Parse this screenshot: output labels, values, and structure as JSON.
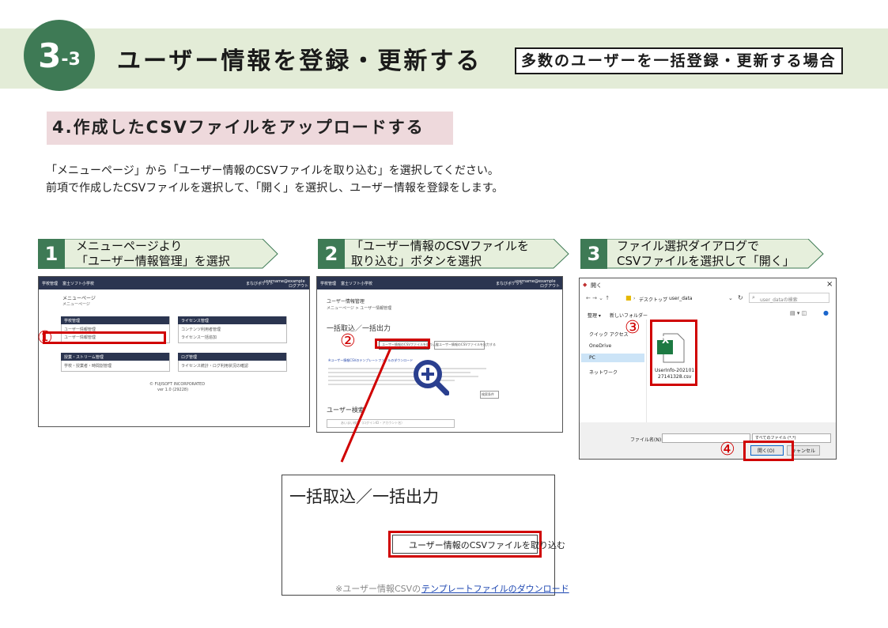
{
  "header": {
    "badge_num": "3",
    "badge_sub": "-3",
    "title": "ユーザー情報を登録・更新する",
    "tag": "多数のユーザーを一括登録・更新する場合"
  },
  "section": {
    "title": "4.作成したCSVファイルをアップロードする"
  },
  "description": {
    "line1": "「メニューページ」から「ユーザー情報のCSVファイルを取り込む」を選択してください。",
    "line2": "前項で作成したCSVファイルを選択して、「開く」を選択し、ユーザー情報を登録をします。"
  },
  "steps": [
    {
      "num": "1",
      "line1": "メニューページより",
      "line2": "「ユーザー情報管理」を選択"
    },
    {
      "num": "2",
      "line1": "「ユーザー情報のCSVファイルを",
      "line2": "取り込む」ボタンを選択"
    },
    {
      "num": "3",
      "line1": "ファイル選択ダイアログで",
      "line2": "CSVファイルを選択して「開く」"
    }
  ],
  "markers": [
    "①",
    "②",
    "③",
    "④"
  ],
  "shot1": {
    "app_title": "学校管理",
    "school": "富士ソフト小学校",
    "brand": "まなびポケット",
    "user": "username@example",
    "logout": "ログアウト",
    "menu": "メニューページ",
    "menu_sub": "メニューページ",
    "card1_title": "学校管理",
    "card1_item1": "ユーザー情報管理",
    "card1_item2": "ユーザー情報管理",
    "card2_title": "ライセンス管理",
    "card2_item1": "コンテンツ利用者管理",
    "card2_item2": "ライセンス一括追加",
    "card3_title": "授業・ストリーム管理",
    "card3_item1": "学校・授業者・時間割管理",
    "card4_title": "ログ管理",
    "card4_item1": "ライセンス統計・ログ利用状況の確認",
    "footer1": "© FUJISOFT INCORPORATED",
    "footer2": "ver 1.0 (29228)"
  },
  "shot2": {
    "app_title": "学校管理",
    "school": "富士ソフト小学校",
    "brand": "まなびポケット",
    "user": "username@example",
    "logout": "ログアウト",
    "page": "ユーザー情報管理",
    "crumb": "メニューページ > ユーザー情報管理",
    "section": "一括取込／一括出力",
    "import_btn": "ユーザー情報のCSVファイルを取り込む",
    "export_btn": "全ユーザー情報のCSVファイルを出力する",
    "note": "※ユーザー情報CSVのテンプレートファイルのダウンロード",
    "search": "ユーザー検索",
    "search_hint": "あいまい検索（ログインID・アカウント名）",
    "small_btn": "検索条件"
  },
  "shot3": {
    "title": "開く",
    "close": "×",
    "path_sep": "›",
    "path1": "デスクトップ",
    "path2": "user_data",
    "search": "user_dataの検索",
    "organize": "整理 ▾",
    "newfolder": "新しいフォルダー",
    "nav1": "クイック アクセス",
    "nav2": "OneDrive",
    "nav3": "PC",
    "nav4": "ネットワーク",
    "file_line1": "UserInfo-202101",
    "file_line2": "27141328.csv",
    "xl_letter": "X",
    "filename_label": "ファイル名(N):",
    "filetype": "すべてのファイル (*.*)",
    "open_btn": "開く(O)",
    "cancel_btn": "キャンセル"
  },
  "zoom": {
    "heading": "一括取込／一括出力",
    "button": "ユーザー情報のCSVファイルを取り込む",
    "note_prefix": "※ユーザー情報CSVの",
    "note_link": "テンプレートファイルのダウンロード"
  },
  "colors": {
    "green": "#3e7a55",
    "header_bg": "#e3ecd7",
    "section_bg": "#eed9dc",
    "red": "#d00000",
    "arrow_fill": "#e6efdc"
  }
}
